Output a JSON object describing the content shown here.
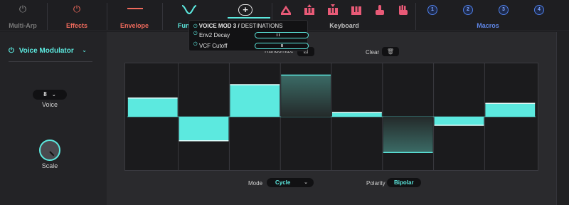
{
  "colors": {
    "accent": "#5ce9df",
    "effects": "#ef6a5c",
    "macro": "#4e7ee6",
    "keyboard_icons": "#e95a77"
  },
  "top_tabs": [
    {
      "id": "multi-arp",
      "label": "Multi-Arp",
      "icon": "power-icon"
    },
    {
      "id": "effects",
      "label": "Effects",
      "icon": "power-icon"
    },
    {
      "id": "envelope",
      "label": "Envelope",
      "icon": "envelope-line-icon"
    },
    {
      "id": "functions",
      "label": "Fun",
      "icon": "wave-icon"
    },
    {
      "id": "add",
      "label": "",
      "icon": "plus-icon"
    },
    {
      "id": "keyboard",
      "label": "Keyboard",
      "icon": "keyboard-icons"
    },
    {
      "id": "macros",
      "label": "Macros",
      "icon": "macro-icons"
    }
  ],
  "macros": [
    "1",
    "2",
    "3",
    "4"
  ],
  "popup": {
    "title_bold": "VOICE MOD 3 /",
    "title_rest": "DESTINATIONS",
    "destinations": [
      {
        "name": "Env2 Decay",
        "amount": 0.3
      },
      {
        "name": "VCF Cutoff",
        "amount": 0.05
      }
    ]
  },
  "left": {
    "module_title": "Voice Modulator",
    "voice_value": "8",
    "voice_label": "Voice",
    "scale_label": "Scale"
  },
  "toolbar": {
    "randomize": "Randomize",
    "clear": "Clear"
  },
  "steps": [
    0.35,
    -0.45,
    0.6,
    0.78,
    0.08,
    -0.67,
    -0.16,
    0.25
  ],
  "steps_dimmed": [
    false,
    false,
    false,
    true,
    false,
    true,
    false,
    false
  ],
  "bottom": {
    "mode_label": "Mode",
    "mode_value": "Cycle",
    "polarity_label": "Polarity",
    "polarity_value": "Bipolar"
  }
}
